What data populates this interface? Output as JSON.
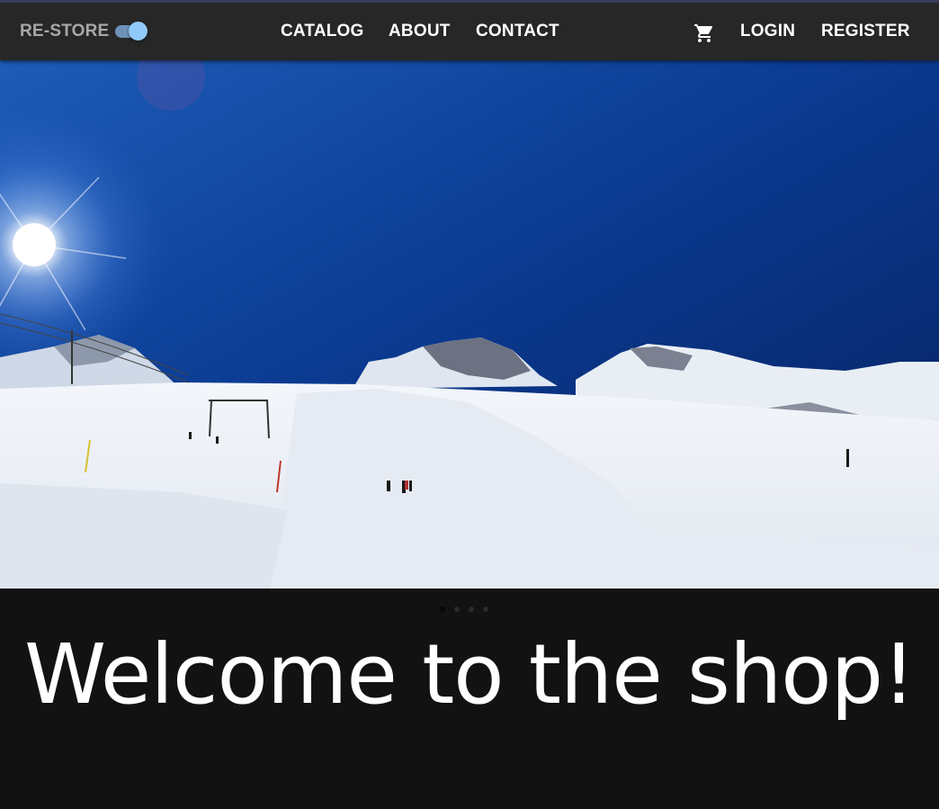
{
  "header": {
    "brand": "RE-STORE",
    "theme_toggle_on": true,
    "nav": {
      "catalog": "CATALOG",
      "about": "ABOUT",
      "contact": "CONTACT"
    },
    "cart_icon": "shopping-cart-icon",
    "auth": {
      "login": "LOGIN",
      "register": "REGISTER"
    }
  },
  "carousel": {
    "slide_count": 4,
    "active_index": 0
  },
  "main": {
    "welcome_text": "Welcome to the shop!"
  },
  "colors": {
    "appbar": "#272727",
    "background": "#121212",
    "toggle_accent": "#90caf9",
    "sky": "#0d3a8c"
  }
}
